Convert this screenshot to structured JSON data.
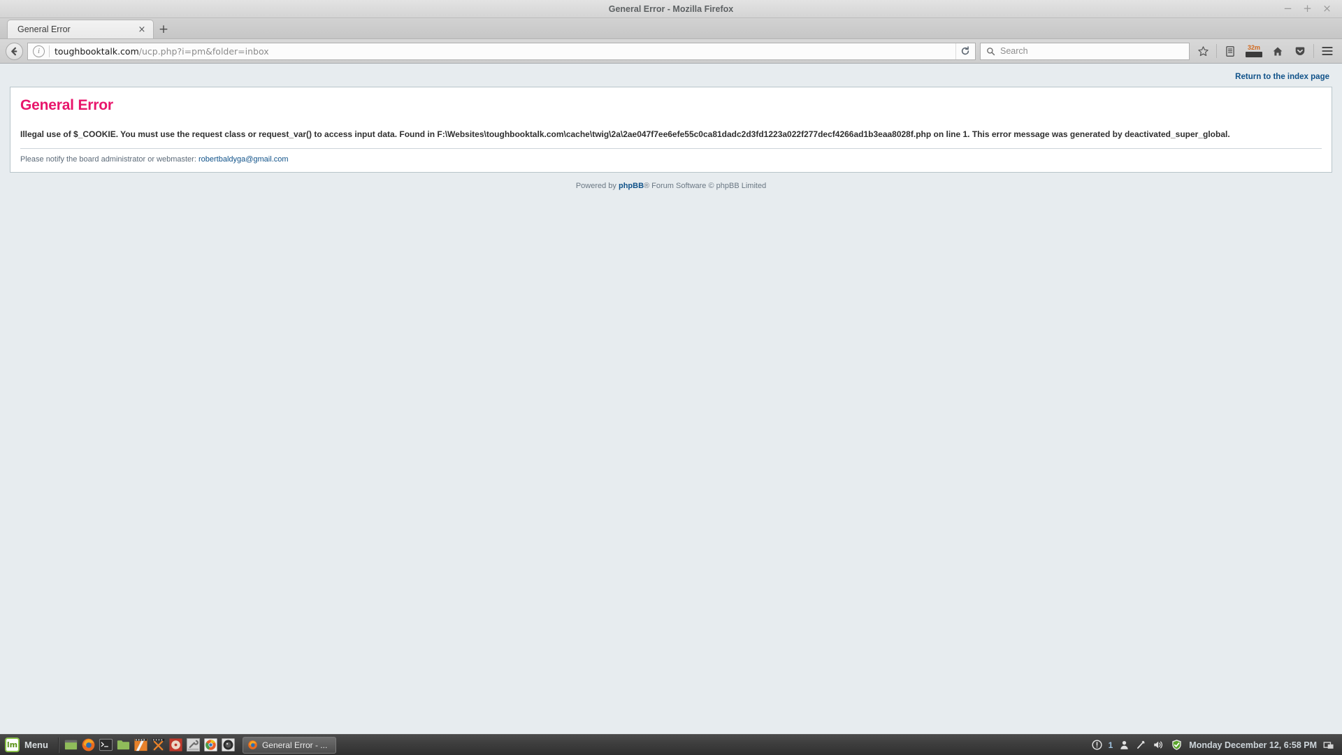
{
  "window": {
    "title": "General Error - Mozilla Firefox",
    "minimize": "−",
    "maximize": "+",
    "close": "×"
  },
  "tabs": {
    "items": [
      {
        "title": "General Error",
        "close": "×"
      }
    ],
    "new_tab": "+"
  },
  "navbar": {
    "url_domain": "toughbooktalk.com",
    "url_path": "/ucp.php?i=pm&folder=inbox",
    "search_placeholder": "Search",
    "battery_label": "32m"
  },
  "page": {
    "return_link": "Return to the index page",
    "error_title": "General Error",
    "error_body": "Illegal use of $_COOKIE. You must use the request class or request_var() to access input data. Found in F:\\Websites\\toughbooktalk.com\\cache\\twig\\2a\\2ae047f7ee6efe55c0ca81dadc2d3fd1223a022f277decf4266ad1b3eaa8028f.php on line 1. This error message was generated by deactivated_super_global.",
    "notify_prefix": "Please notify the board administrator or webmaster:",
    "notify_email": "robertbaldyga@gmail.com",
    "footer_prefix": "Powered by",
    "footer_link": "phpBB",
    "footer_suffix": "® Forum Software © phpBB Limited"
  },
  "taskbar": {
    "menu_label": "Menu",
    "mint_glyph": "lm",
    "window_button": "General Error - ...",
    "tray_count": "1",
    "clock": "Monday December 12,  6:58 PM"
  },
  "colors": {
    "error_pink": "#e8156b",
    "link_blue": "#105289",
    "page_bg": "#e7ecef",
    "battery_orange": "#e8622a"
  }
}
